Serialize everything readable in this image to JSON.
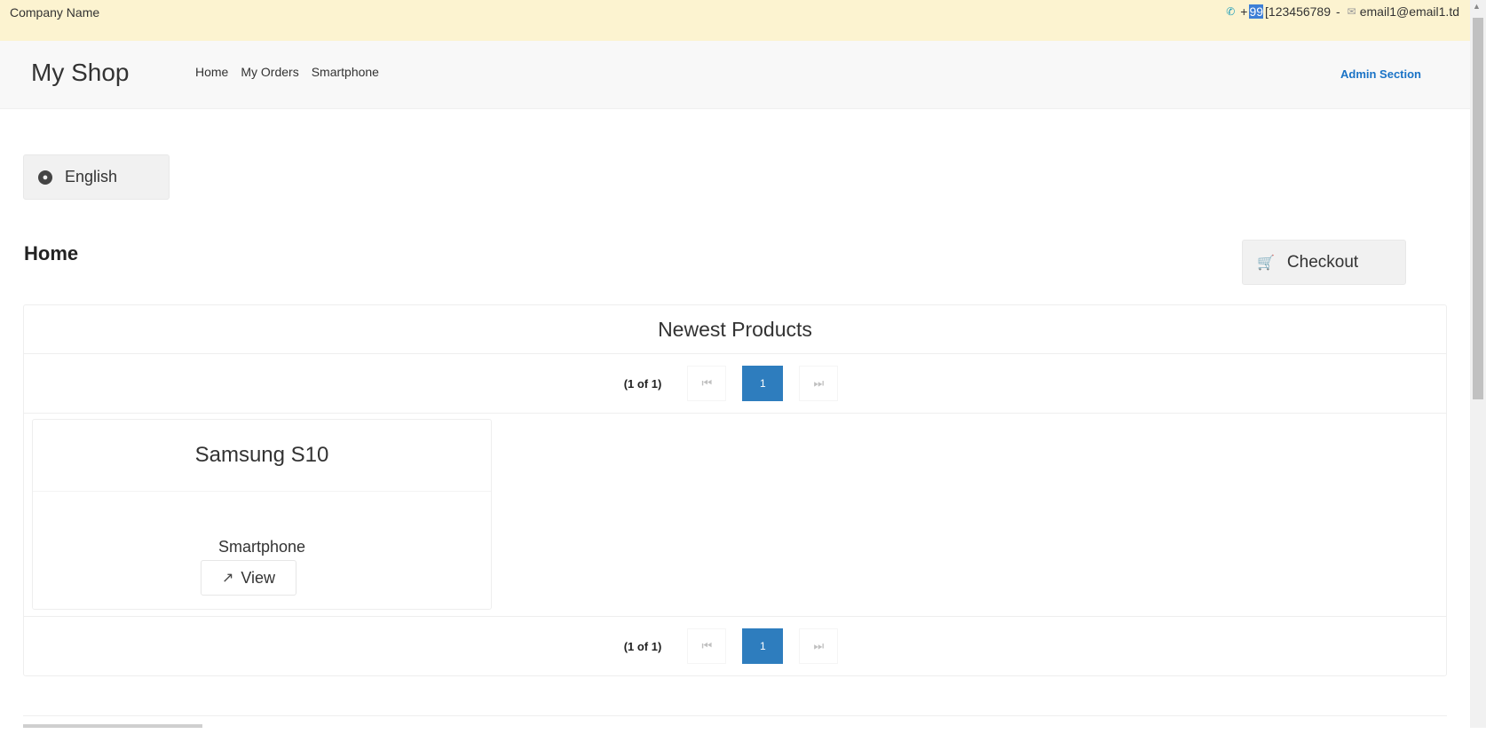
{
  "topbar": {
    "company": "Company Name",
    "phone_prefix": "+",
    "phone_highlight": "99",
    "phone_rest": "[123456789",
    "separator": "-",
    "email": "email1@email1.td"
  },
  "navbar": {
    "brand": "My Shop",
    "items": [
      "Home",
      "My Orders",
      "Smartphone"
    ],
    "admin": "Admin Section"
  },
  "language": {
    "label": "English"
  },
  "page": {
    "title": "Home"
  },
  "checkout": {
    "label": "Checkout"
  },
  "products_panel": {
    "header": "Newest Products",
    "pager": {
      "count": "(1 of 1)",
      "current_page": "1"
    },
    "products": [
      {
        "name": "Samsung S10",
        "category": "Smartphone",
        "view_label": "View"
      }
    ]
  },
  "colors": {
    "topbar": "#fcf3d0",
    "accent": "#2e7dbe",
    "admin_link": "#1a73c6"
  },
  "icons": [
    "phone-icon",
    "mail-icon",
    "globe-icon",
    "cart-icon",
    "first-page-icon",
    "last-page-icon",
    "external-link-icon"
  ]
}
